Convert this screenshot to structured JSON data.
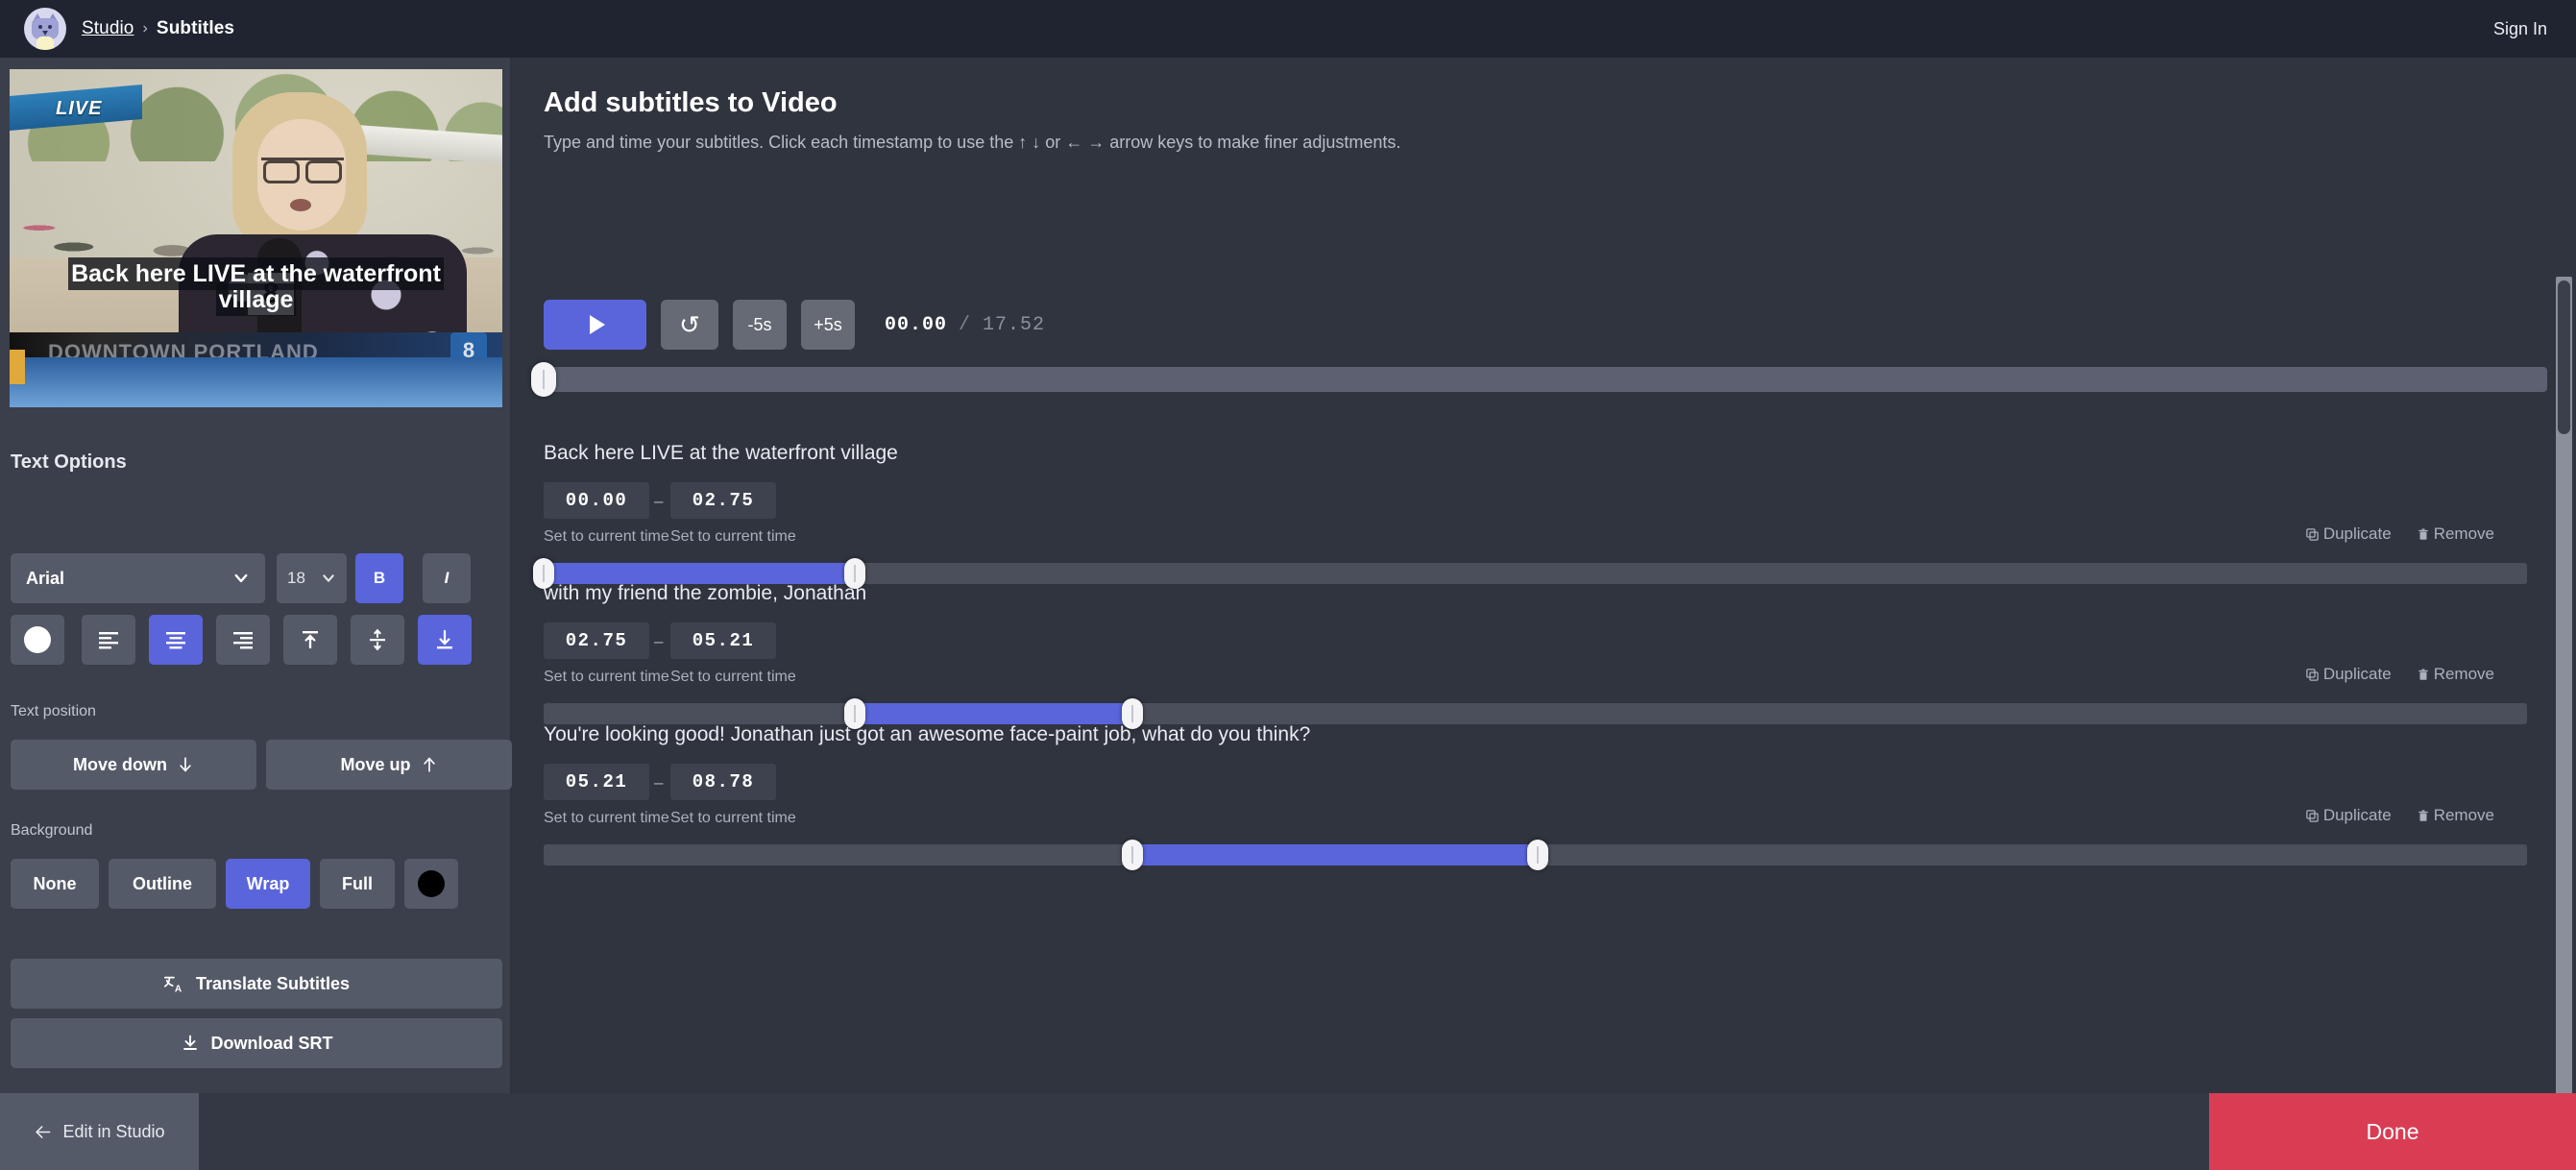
{
  "header": {
    "brand_icon": "cat-avatar-icon",
    "breadcrumb_link": "Studio",
    "breadcrumb_separator": "›",
    "breadcrumb_current": "Subtitles",
    "sign_in": "Sign In"
  },
  "sidebar": {
    "preview": {
      "live_badge": "LIVE",
      "ghost_lower_third": "DOWNTOWN PORTLAND",
      "station_bug": "8",
      "mic_flag": "8",
      "subtitle_overlay_line1": "Back here LIVE at the waterfront",
      "subtitle_overlay_line2": "village"
    },
    "text_options_label": "Text Options",
    "font_family_value": "Arial",
    "font_size_value": "18",
    "bold_label": "B",
    "italic_label": "I",
    "text_color_hex": "#ffffff",
    "align_active": "center",
    "valign_active": "bottom",
    "text_position_label": "Text position",
    "move_down_label": "Move down",
    "move_up_label": "Move up",
    "background_label": "Background",
    "background_options": [
      "None",
      "Outline",
      "Wrap",
      "Full"
    ],
    "background_active": "Wrap",
    "background_color_hex": "#000000",
    "translate_label": "Translate Subtitles",
    "download_label": "Download SRT"
  },
  "main": {
    "title": "Add subtitles to Video",
    "description": "Type and time your subtitles. Click each timestamp to use the ↑ ↓ or ← → arrow keys to make finer adjustments.",
    "player": {
      "play_label": "",
      "restart_label": "↺",
      "back5_label": "-5s",
      "forward5_label": "+5s",
      "current_time": "00.00",
      "time_separator": "/",
      "total_time": "17.52",
      "scrub_position_percent": 0
    },
    "row_actions": {
      "duplicate_label": "Duplicate",
      "remove_label": "Remove"
    },
    "set_current_time_label": "Set to current time",
    "timestamp_separator": "–",
    "subtitles": [
      {
        "text": "Back here LIVE at the waterfront village",
        "start": "00.00",
        "end": "02.75",
        "start_percent": 0.0,
        "end_percent": 15.7
      },
      {
        "text": "with my friend the zombie, Jonathan",
        "start": "02.75",
        "end": "05.21",
        "start_percent": 15.7,
        "end_percent": 29.7
      },
      {
        "text": "You're looking good! Jonathan just got an awesome face-paint job, what do you think?",
        "start": "05.21",
        "end": "08.78",
        "start_percent": 29.7,
        "end_percent": 50.1
      }
    ]
  },
  "footer": {
    "edit_in_studio_label": "Edit in Studio",
    "done_label": "Done"
  },
  "colors": {
    "accent": "#5a65dc",
    "danger": "#d93d54",
    "panel": "#3b3f4b",
    "canvas": "#30343f",
    "topbar": "#1f2430"
  }
}
